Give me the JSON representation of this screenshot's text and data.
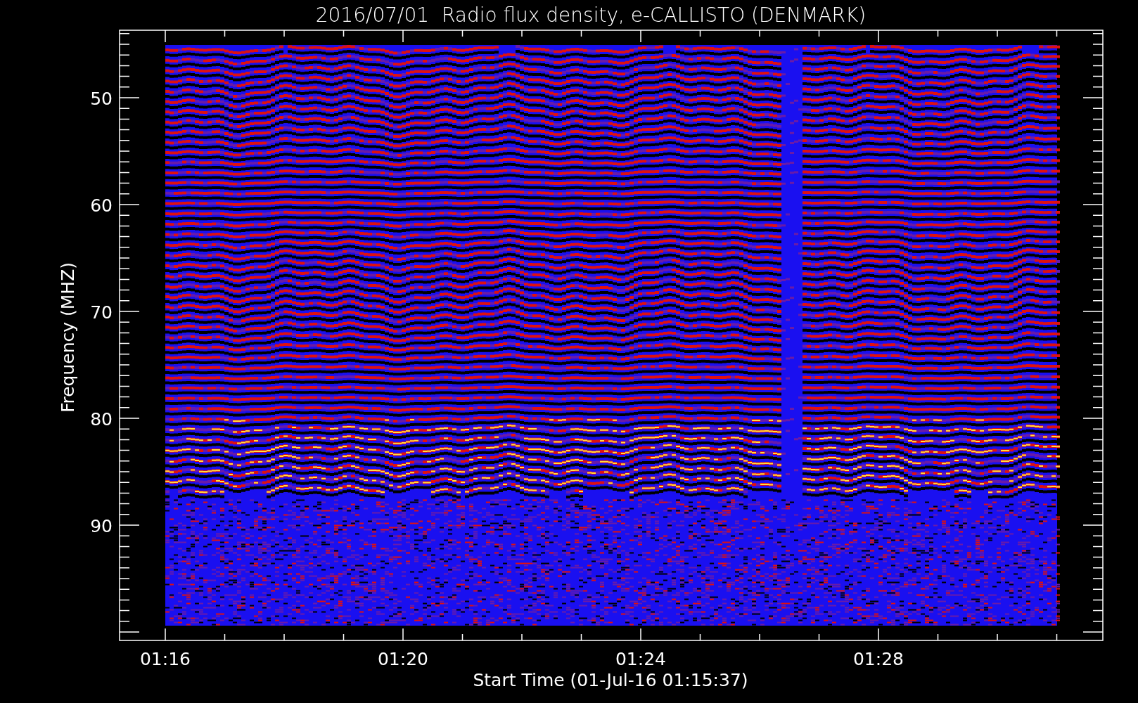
{
  "chart": {
    "title": "2016/07/01  Radio flux density, e-CALLISTO (DENMARK)",
    "ylabel": "Frequency (MHZ)",
    "xlabel": "Start Time (01-Jul-16 01:15:37)",
    "yticks": [
      "50",
      "60",
      "70",
      "80",
      "90"
    ],
    "xticks": [
      "01:16",
      "01:20",
      "01:24",
      "01:28"
    ]
  }
}
